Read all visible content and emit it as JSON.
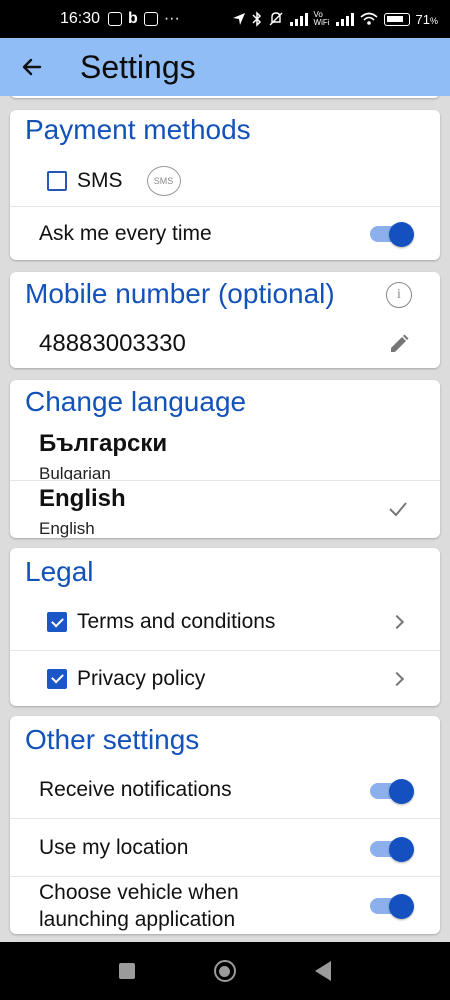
{
  "status_bar": {
    "time": "16:30",
    "battery": "71",
    "carrier_label": "Vo\nWiFi"
  },
  "header": {
    "title": "Settings"
  },
  "payment": {
    "title": "Payment methods",
    "sms_label": "SMS",
    "sms_badge": "SMS",
    "ask_label": "Ask me every time",
    "ask_enabled": true
  },
  "mobile": {
    "title": "Mobile number (optional)",
    "number": "48883003330"
  },
  "language": {
    "title": "Change language",
    "options": [
      {
        "native": "Български",
        "english": "Bulgarian",
        "selected": false
      },
      {
        "native": "English",
        "english": "English",
        "selected": true
      }
    ]
  },
  "legal": {
    "title": "Legal",
    "items": [
      {
        "label": "Terms and conditions",
        "checked": true
      },
      {
        "label": "Privacy policy",
        "checked": true
      }
    ]
  },
  "other": {
    "title": "Other settings",
    "items": [
      {
        "label": "Receive notifications",
        "enabled": true
      },
      {
        "label": "Use my location",
        "enabled": true
      },
      {
        "label": "Choose vehicle when launching application",
        "enabled": true
      }
    ]
  },
  "colors": {
    "accent": "#1352b8",
    "appbar": "#90bdf5",
    "toggle_on": "#1450c0"
  }
}
